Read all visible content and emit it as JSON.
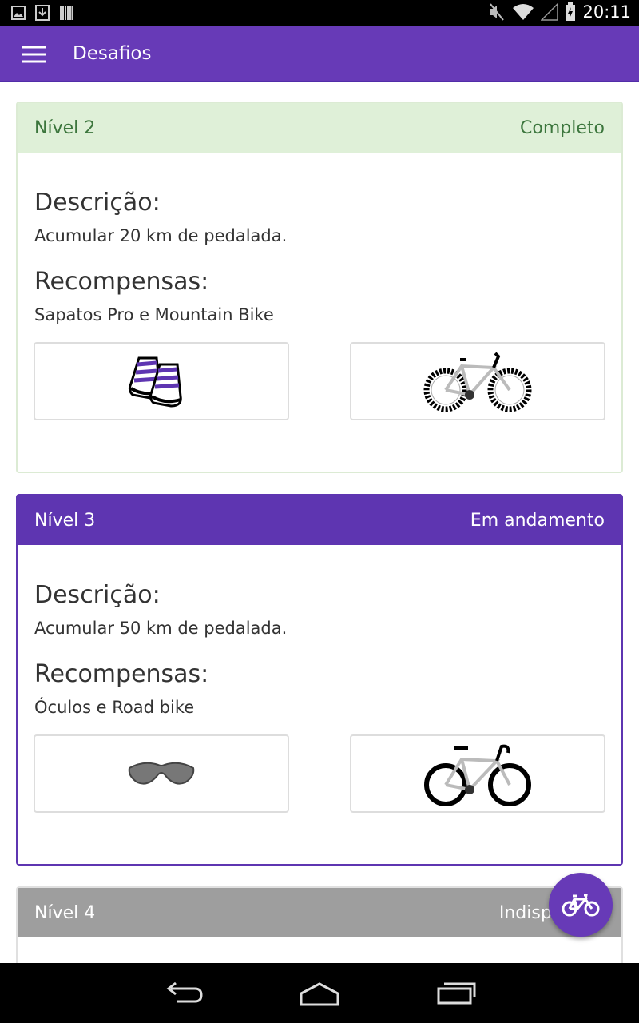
{
  "status_bar": {
    "time": "20:11",
    "left_icons": [
      "image-icon",
      "download-icon",
      "barcode-icon"
    ],
    "right_icons": [
      "mute-icon",
      "wifi-icon",
      "signal-icon",
      "battery-icon"
    ]
  },
  "app_bar": {
    "title": "Desafios",
    "menu_icon": "menu-icon"
  },
  "challenges": [
    {
      "level": "Nível 2",
      "status": "Completo",
      "description_heading": "Descrição:",
      "description": "Acumular 20 km de pedalada.",
      "rewards_heading": "Recompensas:",
      "rewards_text": "Sapatos Pro e Mountain Bike",
      "reward_icons": [
        "shoes-icon",
        "mountain-bike-icon"
      ]
    },
    {
      "level": "Nível 3",
      "status": "Em andamento",
      "description_heading": "Descrição:",
      "description": "Acumular 50 km de pedalada.",
      "rewards_heading": "Recompensas:",
      "rewards_text": "Óculos e Road bike",
      "reward_icons": [
        "glasses-icon",
        "road-bike-icon"
      ]
    },
    {
      "level": "Nível 4",
      "status": "Indisponível"
    }
  ],
  "fab": {
    "icon": "bicycle-icon"
  },
  "nav_bar": {
    "icons": [
      "back-icon",
      "home-icon",
      "recent-apps-icon"
    ]
  },
  "colors": {
    "primary": "#673ab7",
    "primary_dark": "#5e35b1",
    "success_bg": "#dff0d8",
    "success_text": "#3c763d",
    "disabled": "#9e9e9e"
  }
}
